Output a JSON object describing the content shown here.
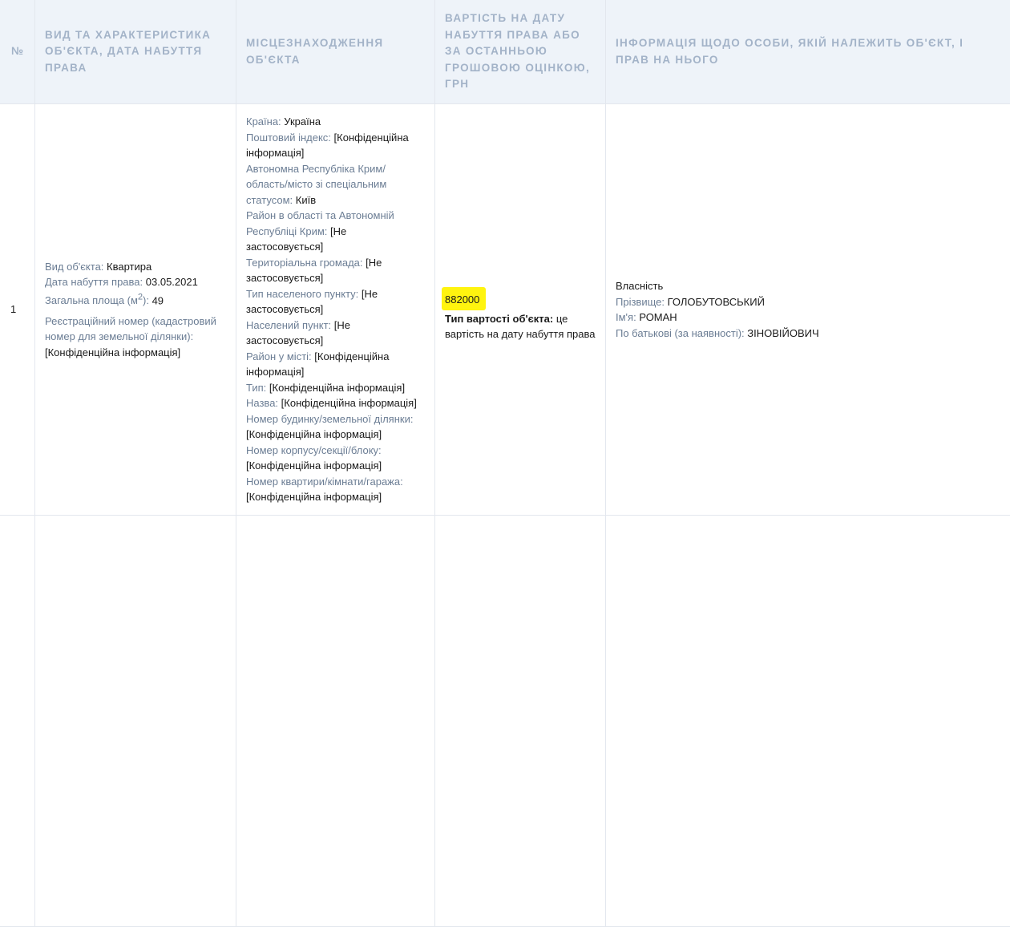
{
  "header": {
    "num": "№",
    "object": "ВИД ТА ХАРАКТЕРИСТИКА ОБ'ЄКТА, ДАТА НАБУТТЯ ПРАВА",
    "location": "МІСЦЕЗНАХОДЖЕННЯ ОБ'ЄКТА",
    "value": "ВАРТІСТЬ НА ДАТУ НАБУТТЯ ПРАВА АБО ЗА ОСТАННЬОЮ ГРОШОВОЮ ОЦІНКОЮ, ГРН",
    "owner": "ІНФОРМАЦІЯ ЩОДО ОСОБИ, ЯКІЙ НАЛЕЖИТЬ ОБ'ЄКТ, І ПРАВ НА НЬОГО"
  },
  "row": {
    "num": "1",
    "object": {
      "type_label": "Вид об'єкта:",
      "type_value": "Квартира",
      "date_label": "Дата набуття права:",
      "date_value": "03.05.2021",
      "area_label_pre": "Загальна площа (м",
      "area_label_sup": "2",
      "area_label_post": "):",
      "area_value": "49",
      "reg_label": "Реєстраційний номер (кадастровий номер для земельної ділянки):",
      "reg_value": "[Конфіденційна інформація]"
    },
    "location": {
      "country_label": "Країна:",
      "country_value": "Україна",
      "postal_label": "Поштовий індекс:",
      "postal_value": "[Конфіденційна інформація]",
      "region_label": "Автономна Республіка Крим/ область/місто зі спеціальним статусом:",
      "region_value": "Київ",
      "district_label": "Район в області та Автономній Республіці Крим:",
      "district_value": "[Не застосовується]",
      "community_label": "Територіальна громада:",
      "community_value": "[Не застосовується]",
      "settlement_type_label": "Тип населеного пункту:",
      "settlement_type_value": "[Не застосовується]",
      "settlement_label": "Населений пункт:",
      "settlement_value": "[Не застосовується]",
      "city_district_label": "Район у місті:",
      "city_district_value": "[Конфіденційна інформація]",
      "street_type_label": "Тип:",
      "street_type_value": "[Конфіденційна інформація]",
      "street_name_label": "Назва:",
      "street_name_value": "[Конфіденційна інформація]",
      "building_label": "Номер будинку/земельної ділянки:",
      "building_value": "[Конфіденційна інформація]",
      "block_label": "Номер корпусу/секції/блоку:",
      "block_value": "[Конфіденційна інформація]",
      "apartment_label": "Номер квартири/кімнати/гаража:",
      "apartment_value": "[Конфіденційна інформація]"
    },
    "value": {
      "amount": "882000",
      "type_label": "Тип вартості об'єкта:",
      "type_value": "це вартість на дату набуття права",
      "highlight_color": "#fff40f"
    },
    "owner": {
      "right": "Власність",
      "surname_label": "Прізвище:",
      "surname_value": "ГОЛОБУТОВСЬКИЙ",
      "name_label": "Ім'я:",
      "name_value": "РОМАН",
      "patronymic_label": "По батькові (за наявності):",
      "patronymic_value": "ЗІНОВІЙОВИЧ"
    }
  },
  "colors": {
    "header_bg": "#eef3f9",
    "header_text": "#a3b3c8",
    "label_text": "#6b7d94",
    "border": "#e3e7ee"
  }
}
